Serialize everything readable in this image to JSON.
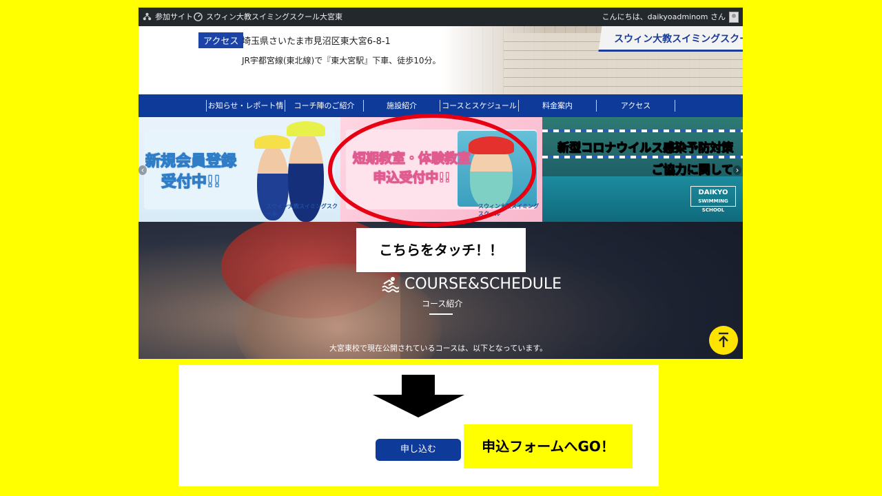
{
  "adminbar": {
    "site_link": "参加サイト",
    "site_name": "スウィン大教スイミングスクール大宮東",
    "greeting": "こんにちは、daikyoadminom さん"
  },
  "header": {
    "access_label": "アクセス",
    "address": "埼玉県さいたま市見沼区東大宮6-8-1",
    "route": "JR宇都宮線(東北線)で『東大宮駅』下車、徒歩10分。",
    "sign_text": "スウィン大教スイミングスクール大宮東"
  },
  "nav": {
    "items": [
      "お知らせ・レポート情報",
      "コーチ陣のご紹介",
      "施設紹介",
      "コースとスケジュール",
      "料金案内",
      "アクセス"
    ]
  },
  "banners": {
    "b1": {
      "line1": "新規会員登録",
      "line2": "受付中!!",
      "logo": "スウィン大教スイミングスクール"
    },
    "b2": {
      "line1": "短期教室・体験教室",
      "line2": "申込受付中!!",
      "logo": "スウィン大教スイミングスクール"
    },
    "b3": {
      "line1": "新型コロナウイルス感染予防対策",
      "line2": "ご協力に関して",
      "logo_line1": "DAIKYO",
      "logo_line2": "SWIMMING SCHOOL"
    },
    "prev_icon": "‹",
    "next_icon": "›"
  },
  "hero": {
    "title": "COURSE&SCHEDULE",
    "subtitle": "コース紹介",
    "description": "大宮東校で現在公開されているコースは、以下となっています。",
    "totop_icon": "arrow-up-icon"
  },
  "annotations": {
    "callout": "こちらをタッチ！！",
    "apply_button": "申し込む",
    "go_label": "申込フォームへGO！",
    "highlight_color": "#E60012",
    "background_color": "#FFFF00"
  }
}
